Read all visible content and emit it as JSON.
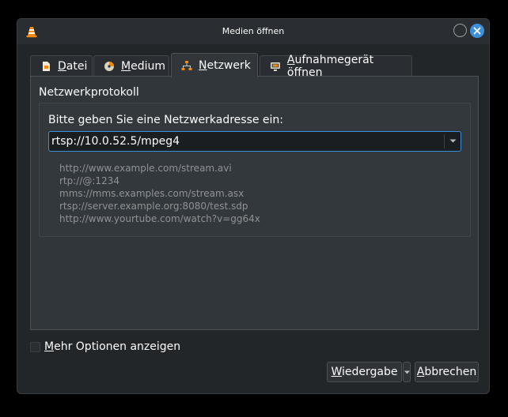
{
  "window": {
    "title": "Medien öffnen",
    "accent": "#3d8fd9"
  },
  "tabs": [
    {
      "label_ul": "D",
      "label_rest": "atei",
      "icon": "file-icon",
      "active": false
    },
    {
      "label_ul": "M",
      "label_rest": "edium",
      "icon": "disc-icon",
      "active": false
    },
    {
      "label_ul": "N",
      "label_rest": "etzwerk",
      "icon": "network-icon",
      "active": true
    },
    {
      "label_ul": "A",
      "label_rest": "ufnahmegerät öffnen",
      "icon": "capture-device-icon",
      "active": false
    }
  ],
  "network": {
    "group_title": "Netzwerkprotokoll",
    "prompt": "Bitte geben Sie eine Netzwerkadresse ein:",
    "address_value": "rtsp://10.0.52.5/mpeg4",
    "examples": [
      "http://www.example.com/stream.avi",
      "rtp://@:1234",
      "mms://mms.examples.com/stream.asx",
      "rtsp://server.example.org:8080/test.sdp",
      "http://www.yourtube.com/watch?v=gg64x"
    ]
  },
  "options": {
    "more_ul": "M",
    "more_rest": "ehr Optionen anzeigen",
    "checked": false
  },
  "buttons": {
    "play_ul": "W",
    "play_rest": "iedergabe",
    "cancel_ul": "A",
    "cancel_rest": "bbrechen"
  }
}
